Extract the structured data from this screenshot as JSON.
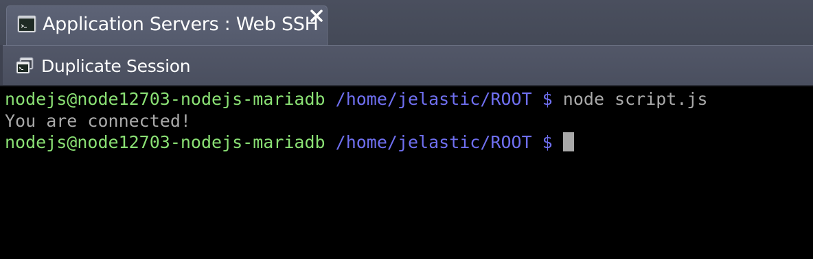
{
  "tab": {
    "title": "Application Servers : Web SSH",
    "icon": "terminal-icon",
    "close_icon": "close-icon"
  },
  "toolbar": {
    "duplicate_label": "Duplicate Session",
    "duplicate_icon": "duplicate-terminal-icon"
  },
  "terminal": {
    "lines": [
      {
        "user": "nodejs@node12703-nodejs-mariadb",
        "path": " /home/jelastic/ROOT $",
        "command": " node script.js"
      },
      {
        "output": "You are connected!"
      },
      {
        "user": "nodejs@node12703-nodejs-mariadb",
        "path": " /home/jelastic/ROOT $",
        "command": " "
      }
    ]
  },
  "colors": {
    "prompt_user": "#8ae074",
    "prompt_path": "#6f6ff0",
    "output_text": "#a9a9a9",
    "background": "#000000"
  }
}
